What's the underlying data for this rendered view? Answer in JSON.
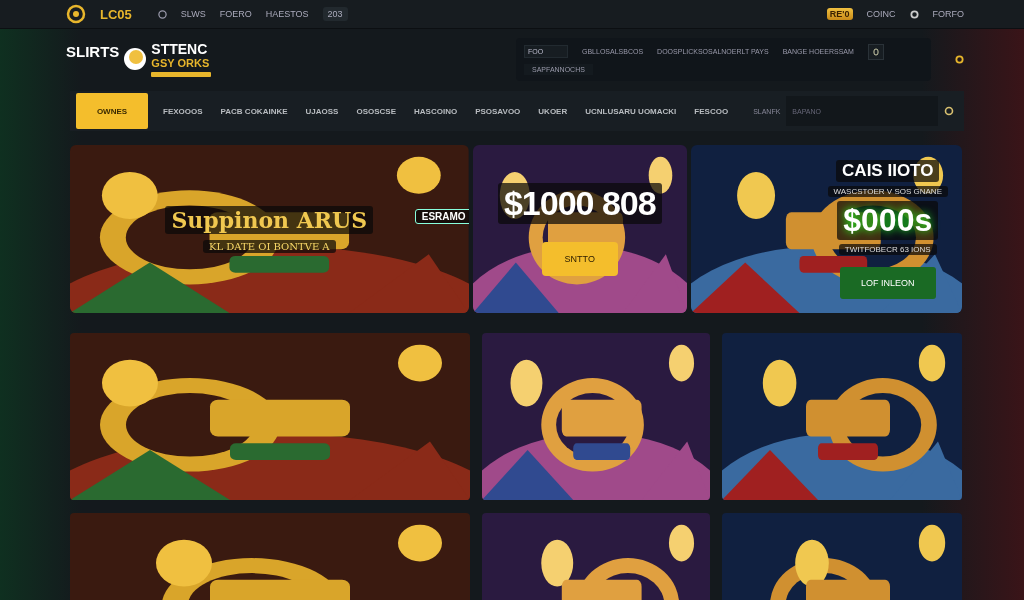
{
  "topbar": {
    "brand": "LC05",
    "links": [
      "SLWS",
      "FOERO",
      "HAESTOS"
    ],
    "badge": "203",
    "coins": "RE'0",
    "account": "COINC",
    "login": "FORFO"
  },
  "header": {
    "logo": {
      "left": "SLIRTS",
      "title": "STTENC",
      "subtitle": "GSY ORKS"
    },
    "panel": {
      "field": "FOO",
      "items": [
        "GBLLOSALSBCOS",
        "DOOSPLICKSOSALNOERLT PAYS",
        "BANGE HOEERSSAM"
      ],
      "note": "SAPFANNOCHS"
    }
  },
  "nav": {
    "tabs": [
      {
        "label": "OWNES",
        "selected": true
      },
      {
        "label": "FEXOOOS",
        "selected": false
      },
      {
        "label": "PACB COKAINKE",
        "selected": false
      },
      {
        "label": "UJAOSS",
        "selected": false
      },
      {
        "label": "OSOSCSE",
        "selected": false
      },
      {
        "label": "HASCOINO",
        "selected": false
      },
      {
        "label": "PSOSAVOO",
        "selected": false
      },
      {
        "label": "UKOER",
        "selected": false
      },
      {
        "label": "UCNLUSARU UOMACKI",
        "selected": false
      },
      {
        "label": "FESCOO",
        "selected": false
      }
    ],
    "search": {
      "label": "SLANFK",
      "placeholder": "BAPANO"
    }
  },
  "banners": [
    {
      "kind": "roulette",
      "title": "Suppinon ARUS",
      "subtitle": "KL DATE OI BONTVE A",
      "badge": "ESRAMO"
    },
    {
      "kind": "jackpot",
      "amount": "$1000 808",
      "button": "SNTTO"
    },
    {
      "kind": "offer",
      "title": "CAIS IIOTO",
      "kicker": "WASCSTOER V SOS GNANE",
      "amount": "$000s",
      "caption": "TWITFOBECR 63 IONS",
      "button": "LOF INLEON"
    }
  ]
}
